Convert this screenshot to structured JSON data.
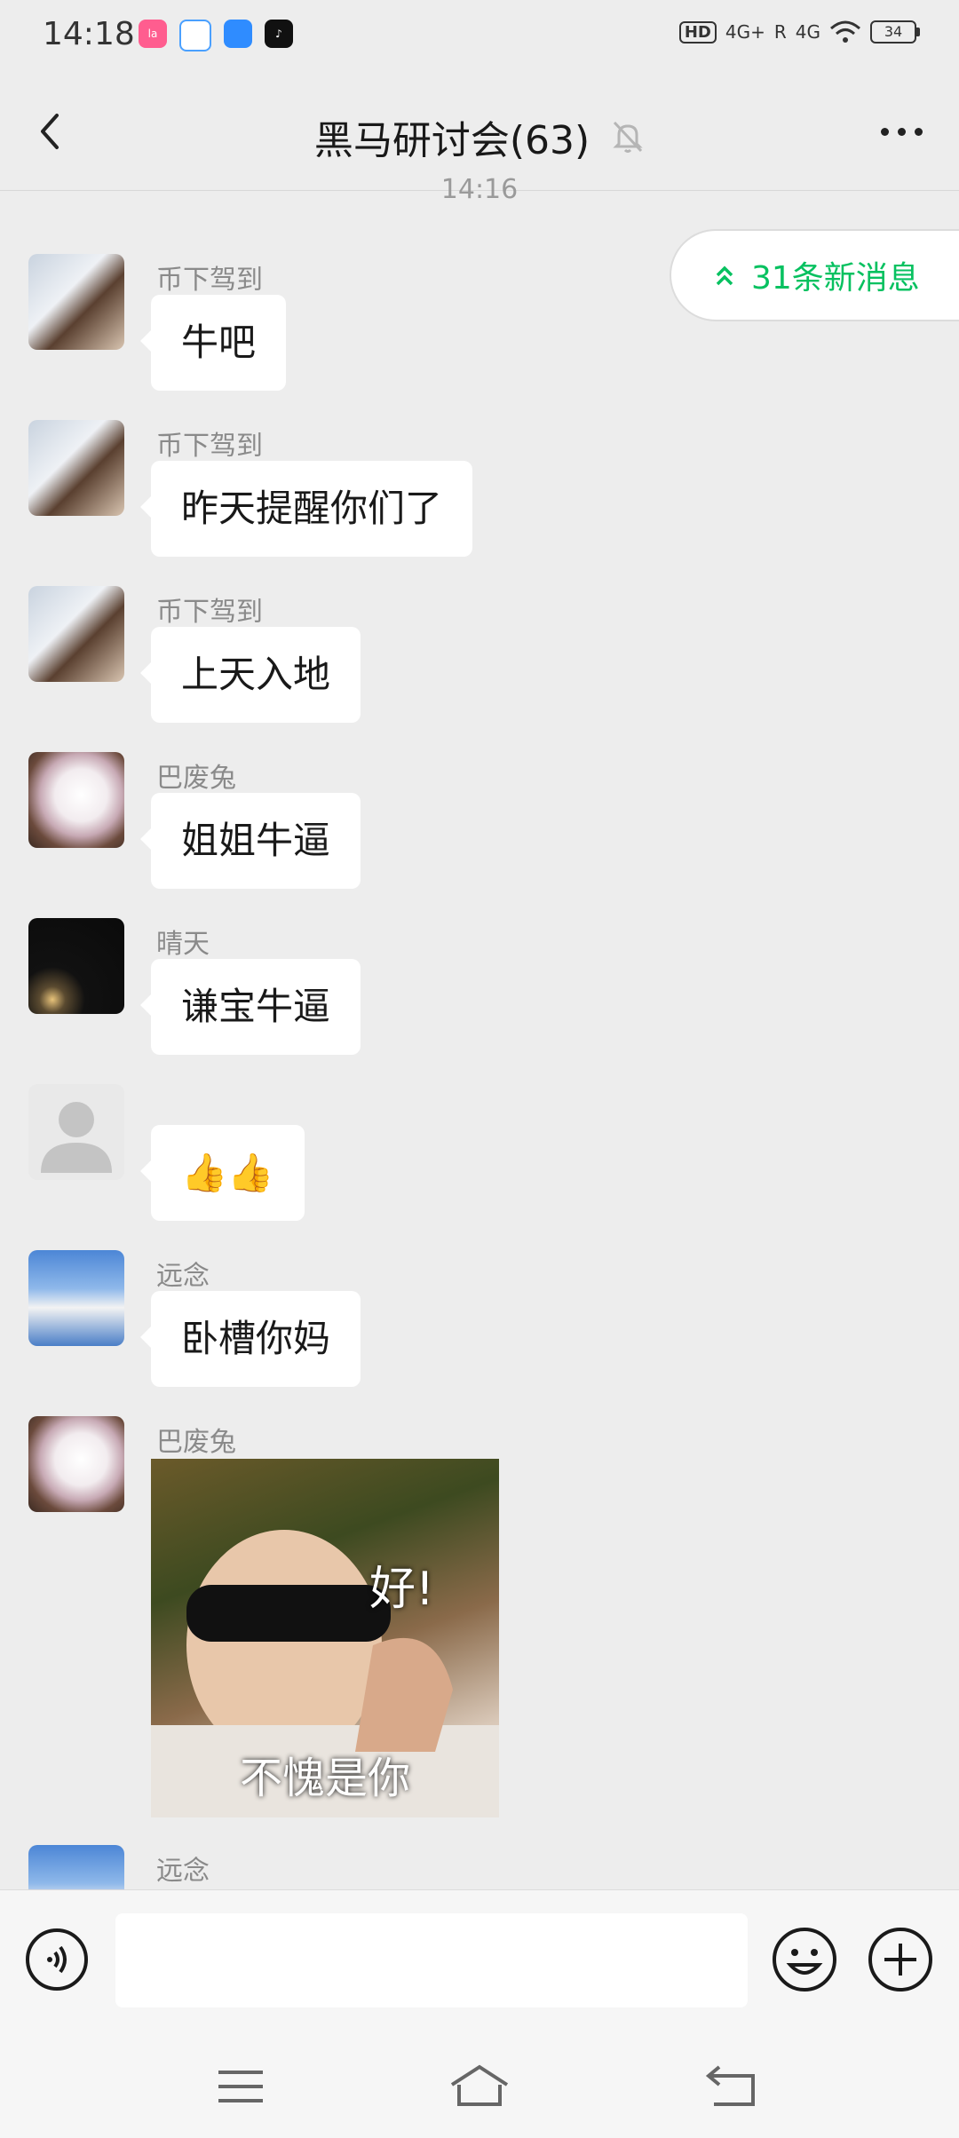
{
  "status_bar": {
    "time": "14:18",
    "apps": [
      "lala-app-icon",
      "baidu-netdisk-icon",
      "feishu-icon",
      "tiktok-icon"
    ],
    "hd": "HD",
    "network1": "4G+",
    "network2": "4G",
    "roaming": "R",
    "battery": "34"
  },
  "header": {
    "title": "黑马研讨会(63)"
  },
  "timestamp": "14:16",
  "new_messages": {
    "label": "31条新消息"
  },
  "messages": [
    {
      "sender": "币下驾到",
      "text": "牛吧"
    },
    {
      "sender": "币下驾到",
      "text": "昨天提醒你们了"
    },
    {
      "sender": "币下驾到",
      "text": "上天入地"
    },
    {
      "sender": "巴废兔",
      "text": "姐姐牛逼"
    },
    {
      "sender": "晴天",
      "text": "谦宝牛逼"
    },
    {
      "sender": "",
      "text": "👍👍"
    },
    {
      "sender": "远念",
      "text": "卧槽你妈"
    },
    {
      "sender": "巴废兔",
      "sticker_caption_top": "好!",
      "sticker_caption_bottom": "不愧是你"
    },
    {
      "sender": "远念"
    }
  ],
  "colors": {
    "accent": "#07c160",
    "background": "#ededed",
    "bubble": "#ffffff"
  }
}
